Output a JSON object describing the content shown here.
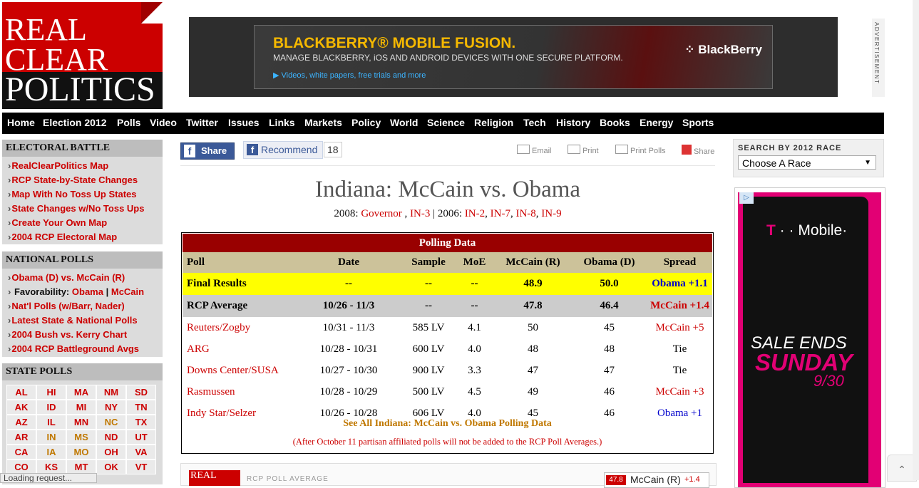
{
  "logo": {
    "line1": "REAL",
    "line2": "CLEAR",
    "line3": "POLITICS"
  },
  "top_ad": {
    "headline": "BLACKBERRY® MOBILE FUSION.",
    "subline": "MANAGE BLACKBERRY, iOS AND ANDROID DEVICES WITH ONE SECURE PLATFORM.",
    "link": "Videos, white papers, free trials and more",
    "brand": "BlackBerry",
    "label": "ADVERTISEMENT"
  },
  "nav": [
    "Home",
    "Election 2012",
    "Polls",
    "Video",
    "Twitter",
    "Issues",
    "Links",
    "Markets",
    "Policy",
    "World",
    "Science",
    "Religion",
    "Tech",
    "History",
    "Books",
    "Energy",
    "Sports"
  ],
  "electoral_battle": {
    "heading": "ELECTORAL BATTLE",
    "items": [
      "RealClearPolitics Map",
      "RCP State-by-State Changes",
      "Map With No Toss Up States",
      "State Changes w/No Toss Ups",
      "Create Your Own Map",
      "2004 RCP Electoral Map"
    ]
  },
  "national_polls": {
    "heading": "NATIONAL POLLS",
    "item0": "Obama (D) vs. McCain (R)",
    "fav_label": "Favorability:",
    "fav_obama": "Obama",
    "fav_sep": "|",
    "fav_mccain": "McCain",
    "item2": "Nat'l Polls (w/Barr, Nader)",
    "item3": "Latest State & National Polls",
    "item4": "2004 Bush vs. Kerry Chart",
    "item5": "2004 RCP Battleground Avgs"
  },
  "state_polls": {
    "heading": "STATE POLLS",
    "states": [
      {
        "code": "AL",
        "tossup": false
      },
      {
        "code": "HI",
        "tossup": false
      },
      {
        "code": "MA",
        "tossup": false
      },
      {
        "code": "NM",
        "tossup": false
      },
      {
        "code": "SD",
        "tossup": false
      },
      {
        "code": "AK",
        "tossup": false
      },
      {
        "code": "ID",
        "tossup": false
      },
      {
        "code": "MI",
        "tossup": false
      },
      {
        "code": "NY",
        "tossup": false
      },
      {
        "code": "TN",
        "tossup": false
      },
      {
        "code": "AZ",
        "tossup": false
      },
      {
        "code": "IL",
        "tossup": false
      },
      {
        "code": "MN",
        "tossup": false
      },
      {
        "code": "NC",
        "tossup": true
      },
      {
        "code": "TX",
        "tossup": false
      },
      {
        "code": "AR",
        "tossup": false
      },
      {
        "code": "IN",
        "tossup": true
      },
      {
        "code": "MS",
        "tossup": true
      },
      {
        "code": "ND",
        "tossup": false
      },
      {
        "code": "UT",
        "tossup": false
      },
      {
        "code": "CA",
        "tossup": false
      },
      {
        "code": "IA",
        "tossup": true
      },
      {
        "code": "MO",
        "tossup": true
      },
      {
        "code": "OH",
        "tossup": false
      },
      {
        "code": "VA",
        "tossup": false
      },
      {
        "code": "CO",
        "tossup": false
      },
      {
        "code": "KS",
        "tossup": false
      },
      {
        "code": "MT",
        "tossup": false
      },
      {
        "code": "OK",
        "tossup": false
      },
      {
        "code": "VT",
        "tossup": false
      }
    ]
  },
  "share": {
    "share_label": "Share",
    "recommend_label": "Recommend",
    "recommend_count": "18",
    "email": "Email",
    "print": "Print",
    "print_polls": "Print Polls",
    "share2": "Share"
  },
  "page": {
    "title": "Indiana: McCain vs. Obama",
    "sub_2008": "2008:",
    "sub_governor": "Governor",
    "sub_sep1": ",",
    "sub_in3": "IN-3",
    "sub_mid": "| 2006:",
    "sub_in2": "IN-2",
    "sub_in7": "IN-7",
    "sub_in8": "IN-8",
    "sub_in9": "IN-9"
  },
  "poll_table": {
    "caption": "Polling Data",
    "headers": [
      "Poll",
      "Date",
      "Sample",
      "MoE",
      "McCain (R)",
      "Obama (D)",
      "Spread"
    ],
    "final": {
      "poll": "Final Results",
      "date": "--",
      "sample": "--",
      "moe": "--",
      "mccain": "48.9",
      "obama": "50.0",
      "spread": "Obama +1.1",
      "spread_party": "D"
    },
    "rcp": {
      "poll": "RCP Average",
      "date": "10/26 - 11/3",
      "sample": "--",
      "moe": "--",
      "mccain": "47.8",
      "obama": "46.4",
      "spread": "McCain +1.4",
      "spread_party": "R"
    },
    "rows": [
      {
        "poll": "Reuters/Zogby",
        "date": "10/31 - 11/3",
        "sample": "585 LV",
        "moe": "4.1",
        "mccain": "50",
        "obama": "45",
        "spread": "McCain +5",
        "spread_party": "R"
      },
      {
        "poll": "ARG",
        "date": "10/28 - 10/31",
        "sample": "600 LV",
        "moe": "4.0",
        "mccain": "48",
        "obama": "48",
        "spread": "Tie",
        "spread_party": ""
      },
      {
        "poll": "Downs Center/SUSA",
        "date": "10/27 - 10/30",
        "sample": "900 LV",
        "moe": "3.3",
        "mccain": "47",
        "obama": "47",
        "spread": "Tie",
        "spread_party": ""
      },
      {
        "poll": "Rasmussen",
        "date": "10/28 - 10/29",
        "sample": "500 LV",
        "moe": "4.5",
        "mccain": "49",
        "obama": "46",
        "spread": "McCain +3",
        "spread_party": "R"
      },
      {
        "poll": "Indy Star/Selzer",
        "date": "10/26 - 10/28",
        "sample": "606 LV",
        "moe": "4.0",
        "mccain": "45",
        "obama": "46",
        "spread": "Obama +1",
        "spread_party": "D"
      }
    ],
    "see_all": "See All Indiana: McCain vs. Obama Polling Data",
    "footnote": "(After October 11 partisan affiliated polls will not be added to the RCP Poll Averages.)"
  },
  "teaser": {
    "logo": "REAL",
    "label": "RCP POLL AVERAGE",
    "chip_num": "47.8",
    "chip_name": "McCain (R)",
    "chip_delta": "+1.4"
  },
  "search": {
    "label": "SEARCH BY 2012 RACE",
    "selected": "Choose A Race"
  },
  "side_ad": {
    "brand_t": "T",
    "brand_dots": "· ·",
    "brand_name": "Mobile·",
    "line1": "SALE ENDS",
    "line2": "SUNDAY",
    "line3": "9/30"
  },
  "status": "Loading request..."
}
